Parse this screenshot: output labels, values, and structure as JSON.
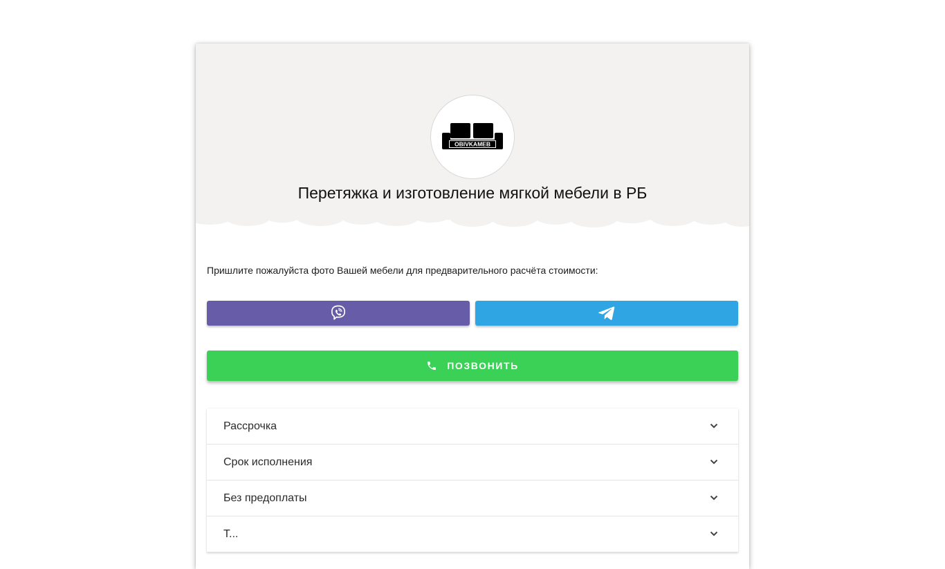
{
  "header": {
    "logo_text": "OBIVKAMEB",
    "title": "Перетяжка и изготовление мягкой мебели в РБ"
  },
  "intro": {
    "text": "Пришлите пожалуйста фото Вашей мебели для предварительного расчёта стоимости:"
  },
  "buttons": {
    "viber_icon": "viber-icon",
    "telegram_icon": "telegram-icon",
    "call_label": "ПОЗВОНИТЬ",
    "call_icon": "phone-icon"
  },
  "accordion": {
    "items": [
      {
        "label": "Рассрочка"
      },
      {
        "label": "Срок исполнения"
      },
      {
        "label": "Без предоплаты"
      },
      {
        "label": "Т..."
      }
    ]
  },
  "colors": {
    "header_bg": "#f3f2f0",
    "viber": "#665ca7",
    "telegram": "#2fa6e3",
    "call": "#3bd156"
  }
}
